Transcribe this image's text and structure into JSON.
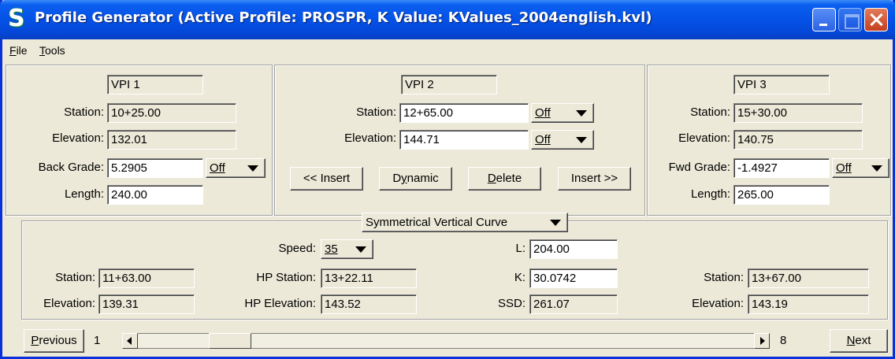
{
  "window": {
    "title": "Profile Generator  (Active Profile: PROSPR,  K Value: KValues_2004english.kvl)",
    "icon": "app-logo-icon"
  },
  "menu": {
    "file_first": "F",
    "file_rest": "ile",
    "tools_first": "T",
    "tools_rest": "ools"
  },
  "vpi1": {
    "title": "VPI 1",
    "station_label": "Station:",
    "station": "10+25.00",
    "elevation_label": "Elevation:",
    "elevation": "132.01",
    "grade_label": "Back Grade:",
    "grade": "5.2905",
    "grade_lock": "Off",
    "length_label": "Length:",
    "length": "240.00"
  },
  "vpi2": {
    "title": "VPI 2",
    "station_label": "Station:",
    "station": "12+65.00",
    "station_lock": "Off",
    "elevation_label": "Elevation:",
    "elevation": "144.71",
    "elevation_lock": "Off"
  },
  "buttons": {
    "insert_before": "<< Insert",
    "dynamic_a": "D",
    "dynamic_u": "y",
    "dynamic_b": "namic",
    "delete_u": "D",
    "delete_rest": "elete",
    "insert_after": "Insert >>"
  },
  "vpi3": {
    "title": "VPI 3",
    "station_label": "Station:",
    "station": "15+30.00",
    "elevation_label": "Elevation:",
    "elevation": "140.75",
    "grade_label": "Fwd Grade:",
    "grade": "-1.4927",
    "grade_lock": "Off",
    "length_label": "Length:",
    "length": "265.00"
  },
  "curve": {
    "type": "Symmetrical Vertical Curve",
    "bvc_station_label": "Station:",
    "bvc_station": "11+63.00",
    "bvc_elevation_label": "Elevation:",
    "bvc_elevation": "139.31",
    "speed_label": "Speed:",
    "speed": "35",
    "hp_station_label": "HP Station:",
    "hp_station": "13+22.11",
    "hp_elevation_label": "HP Elevation:",
    "hp_elevation": "143.52",
    "l_label": "L:",
    "l": "204.00",
    "k_label": "K:",
    "k": "30.0742",
    "ssd_label": "SSD:",
    "ssd": "261.07",
    "evc_station_label": "Station:",
    "evc_station": "13+67.00",
    "evc_elevation_label": "Elevation:",
    "evc_elevation": "143.19"
  },
  "nav": {
    "previous_u": "P",
    "previous_rest": "revious",
    "first_index": "1",
    "last_index": "8",
    "next_u": "N",
    "next_rest": "ext"
  }
}
